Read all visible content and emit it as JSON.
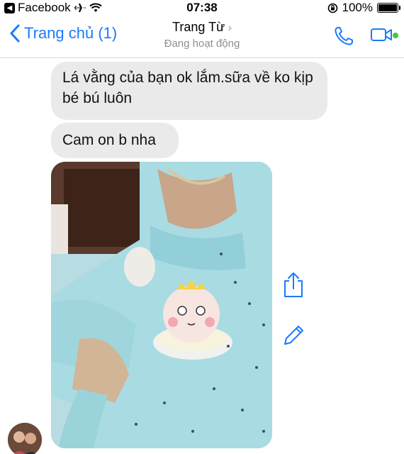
{
  "status_bar": {
    "back_app": "Facebook",
    "time": "07:38",
    "battery": "100%"
  },
  "nav": {
    "back_label": "Trang chủ (1)",
    "contact_name": "Trang Từ",
    "contact_status": "Đang hoạt động"
  },
  "messages": [
    {
      "text": "Lá vằng của bạn ok lắm.sữa về ko kịp bé bú luôn"
    },
    {
      "text": "Cam on b nha"
    }
  ],
  "colors": {
    "accent": "#1a7bff",
    "online": "#3ecc3e",
    "bubble": "#eaeaea"
  },
  "icons": {
    "phone": "phone-icon",
    "video": "video-camera-icon",
    "share": "share-icon",
    "edit": "pencil-icon"
  }
}
